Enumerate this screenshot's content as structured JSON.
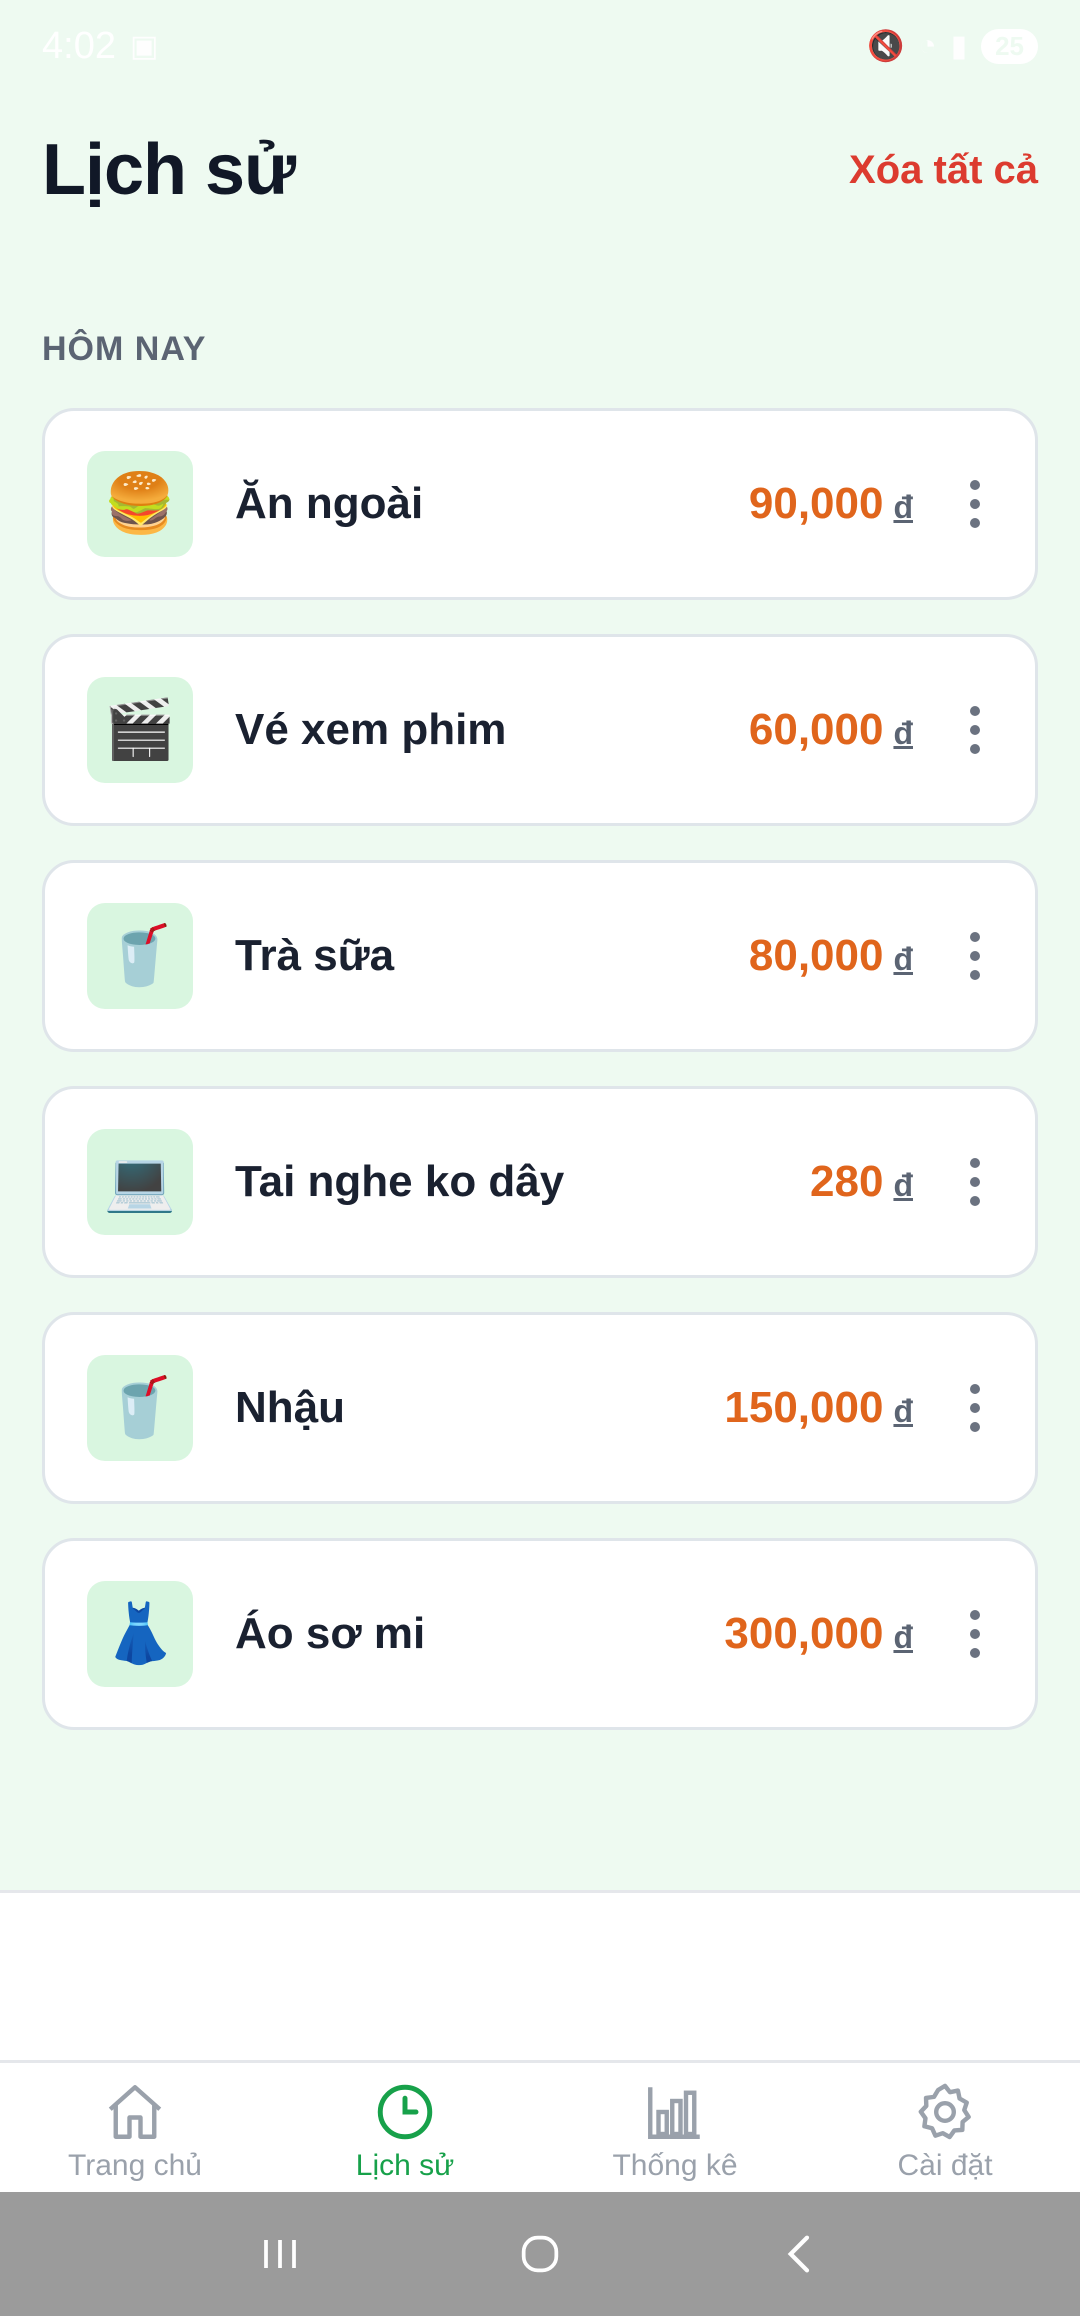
{
  "status_bar": {
    "time": "4:02",
    "battery": "25",
    "icons": [
      "screenshot-icon",
      "mute-icon",
      "wifi-icon",
      "signal-icon",
      "battery-icon"
    ]
  },
  "header": {
    "title": "Lịch sử",
    "clear_all_label": "Xóa tất cả"
  },
  "section": {
    "label": "HÔM NAY"
  },
  "items": [
    {
      "name": "Ăn ngoài",
      "amount": "90,000",
      "currency": "đ",
      "icon": "🍔",
      "icon_name": "hamburger-icon"
    },
    {
      "name": "Vé xem phim",
      "amount": "60,000",
      "currency": "đ",
      "icon": "🎬",
      "icon_name": "clapperboard-icon"
    },
    {
      "name": "Trà sữa",
      "amount": "80,000",
      "currency": "đ",
      "icon": "🥤",
      "icon_name": "cup-with-straw-icon"
    },
    {
      "name": "Tai nghe ko dây",
      "amount": "280",
      "currency": "đ",
      "icon": "💻",
      "icon_name": "laptop-icon"
    },
    {
      "name": "Nhậu",
      "amount": "150,000",
      "currency": "đ",
      "icon": "🥤",
      "icon_name": "cup-with-straw-icon"
    },
    {
      "name": "Áo sơ mi",
      "amount": "300,000",
      "currency": "đ",
      "icon": "👗",
      "icon_name": "dress-icon"
    }
  ],
  "tabs": [
    {
      "label": "Trang chủ",
      "icon": "home-icon",
      "active": false
    },
    {
      "label": "Lịch sử",
      "icon": "clock-icon",
      "active": true
    },
    {
      "label": "Thống kê",
      "icon": "bar-chart-icon",
      "active": false
    },
    {
      "label": "Cài đặt",
      "icon": "gear-icon",
      "active": false
    }
  ],
  "colors": {
    "background": "#eefaf1",
    "accent_green": "#17a14a",
    "amount_orange": "#e0651c",
    "danger_red": "#dc3b2f",
    "icon_box": "#d9f6e0"
  }
}
